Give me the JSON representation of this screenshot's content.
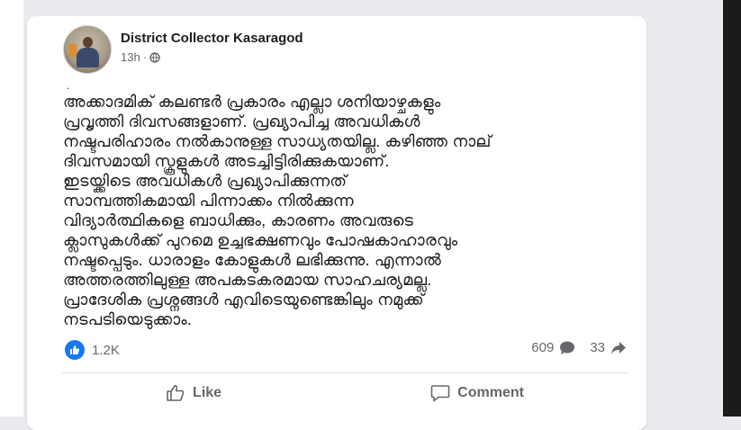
{
  "post": {
    "author": "District Collector Kasaragod",
    "timestamp": "13h",
    "separator": "·",
    "privacy_icon": "globe-icon",
    "leading_mark": ".",
    "body": "അക്കാദമിക് കലണ്ടർ പ്രകാരം എല്ലാ ശനിയാഴ്ചകളും\nപ്രവൃത്തി ദിവസങ്ങളാണ്. പ്രഖ്യാപിച്ച അവധികൾ\nനഷ്ടപരിഹാരം നൽകാനുള്ള സാധ്യതയില്ല. കഴിഞ്ഞ നാല്\nദിവസമായി സ്കൂളുകൾ അടച്ചിട്ടിരിക്കുകയാണ്.\nഇടയ്ക്കിടെ അവധികൾ പ്രഖ്യാപിക്കുന്നത്\nസാമ്പത്തികമായി പിന്നാക്കം നിൽക്കുന്ന\nവിദ്യാർത്ഥികളെ ബാധിക്കും, കാരണം അവരുടെ\nക്ലാസുകൾക്ക് പുറമെ ഉച്ചഭക്ഷണവും പോഷകാഹാരവും\nനഷ്ടപ്പെടും. ധാരാളം കോളുകൾ ലഭിക്കുന്നു. എന്നാൽ\nഅത്തരത്തിലുള്ള അപകടകരമായ സാഹചര്യമല്ല.\nപ്രാദേശിക പ്രശ്നങ്ങൾ എവിടെയുണ്ടെങ്കിലും നമുക്ക്\nനടപടിയെടുക്കാം."
  },
  "stats": {
    "reactions_count": "1.2K",
    "comments_count": "609",
    "shares_count": "33"
  },
  "actions": {
    "like_label": "Like",
    "comment_label": "Comment"
  },
  "colors": {
    "accent": "#1877f2",
    "text": "#1c1e21",
    "secondary": "#65676b"
  }
}
